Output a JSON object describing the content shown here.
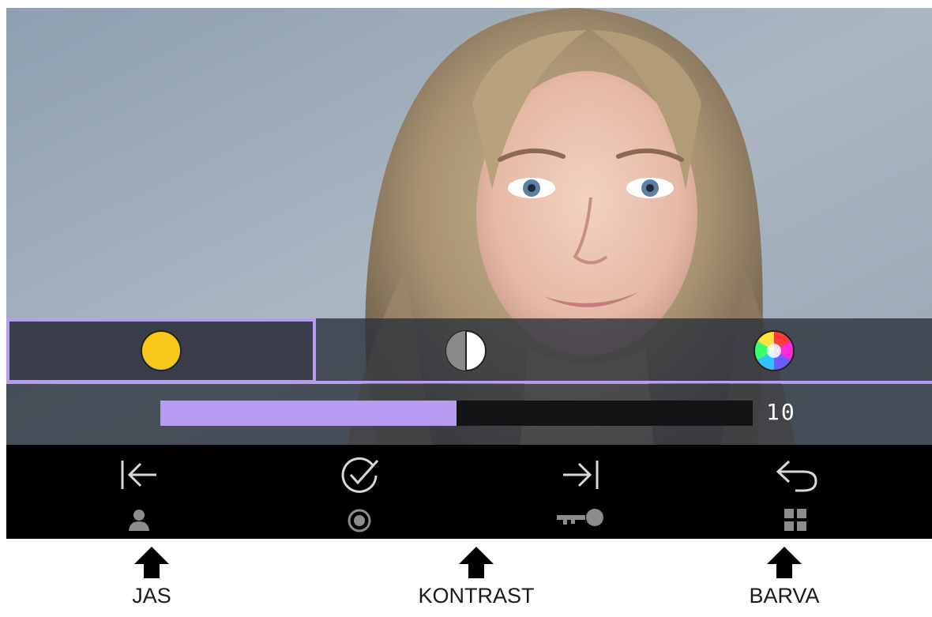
{
  "screen": {
    "modes": [
      {
        "id": "brightness",
        "icon": "sun-dot-icon",
        "color": "#f7c81c",
        "selected": true
      },
      {
        "id": "contrast",
        "icon": "contrast-half-circle-icon",
        "selected": false
      },
      {
        "id": "color",
        "icon": "color-wheel-icon",
        "selected": false
      }
    ],
    "slider": {
      "value_label": "10",
      "fill_fraction": 0.5,
      "fill_color": "#b79cf2"
    },
    "controls": [
      {
        "main_icon": "arrow-left-to-bar-icon",
        "sub_icon": "person-icon"
      },
      {
        "main_icon": "check-circle-icon",
        "sub_icon": "record-dot-icon"
      },
      {
        "main_icon": "arrow-right-to-bar-icon",
        "sub_icon": "key-icon"
      },
      {
        "main_icon": "undo-return-icon",
        "sub_icon": "grid-icon"
      }
    ]
  },
  "annotations": [
    {
      "label": "JAS",
      "icon": "up-arrow-icon"
    },
    {
      "label": "KONTRAST",
      "icon": "up-arrow-icon"
    },
    {
      "label": "BARVA",
      "icon": "up-arrow-icon"
    }
  ],
  "colors": {
    "accent": "#b79cf2",
    "brightness_dot": "#f7c81c",
    "bar_background": "#000000"
  }
}
